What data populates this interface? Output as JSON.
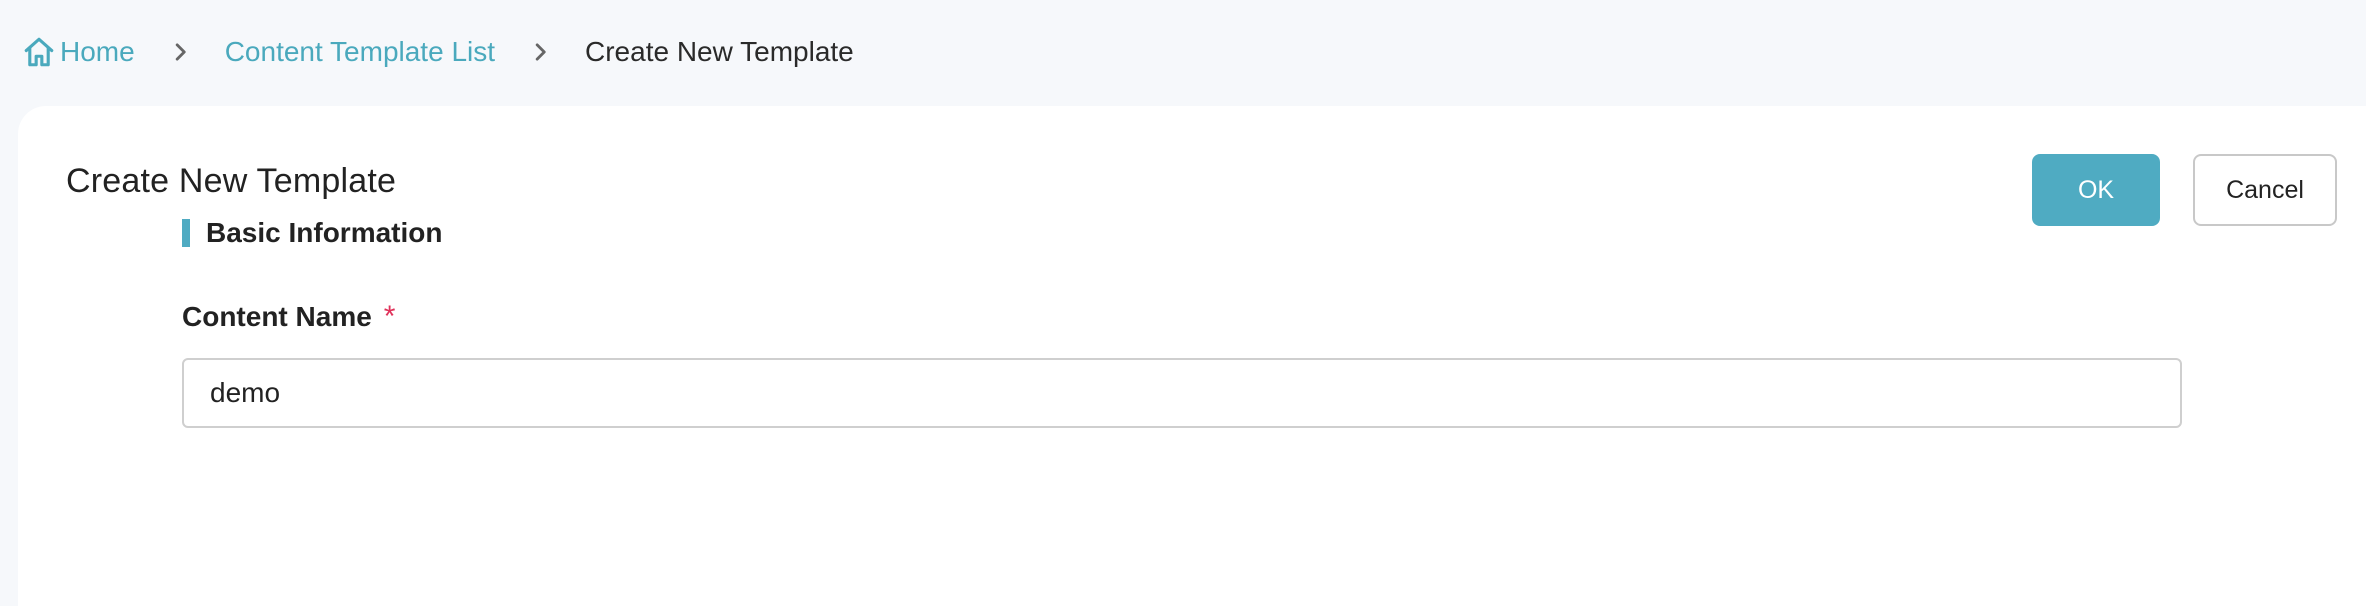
{
  "breadcrumb": {
    "home": "Home",
    "list": "Content Template List",
    "current": "Create New Template"
  },
  "header": {
    "title": "Create New Template",
    "ok_label": "OK",
    "cancel_label": "Cancel"
  },
  "section": {
    "title": "Basic Information"
  },
  "form": {
    "content_name": {
      "label": "Content Name",
      "required_mark": "*",
      "value": "demo"
    }
  },
  "colors": {
    "accent": "#4fabc2",
    "link": "#4aa9bd",
    "required": "#e0325a",
    "page_bg": "#f6f8fb"
  },
  "icons": {
    "home": "home-icon",
    "separator": "chevron-right-icon"
  }
}
